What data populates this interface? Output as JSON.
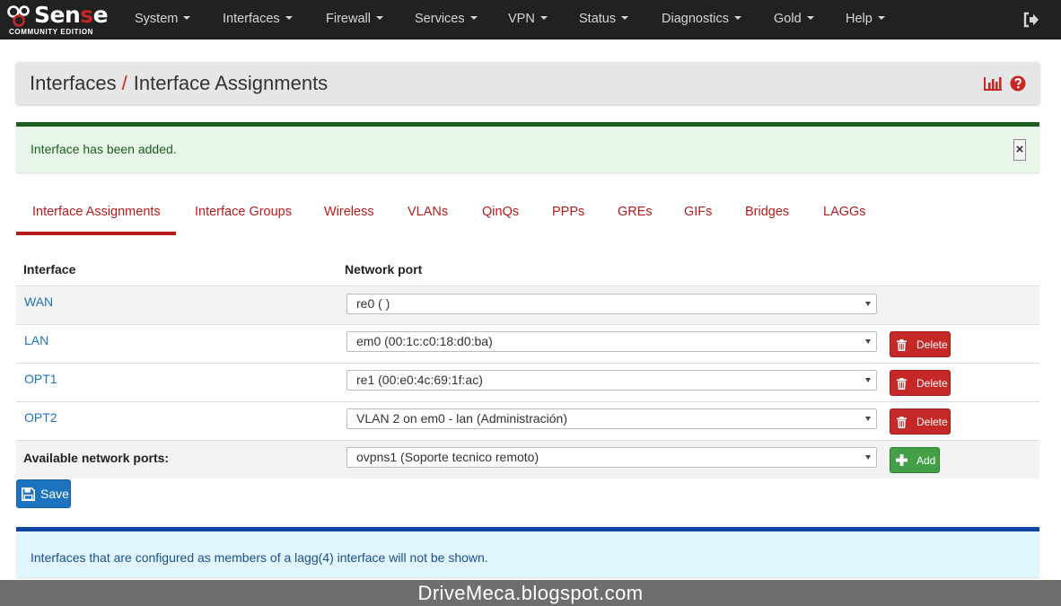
{
  "brand": {
    "name_white_1": "Sen",
    "name_red": "s",
    "name_white_2": "e",
    "edition": "COMMUNITY EDITION"
  },
  "nav": {
    "items": [
      "System",
      "Interfaces",
      "Firewall",
      "Services",
      "VPN",
      "Status",
      "Diagnostics",
      "Gold",
      "Help"
    ]
  },
  "header": {
    "section": "Interfaces",
    "separator": "/",
    "title": "Interface Assignments"
  },
  "alert_success": {
    "message": "Interface has been added.",
    "close": "×"
  },
  "tabs": [
    "Interface Assignments",
    "Interface Groups",
    "Wireless",
    "VLANs",
    "QinQs",
    "PPPs",
    "GREs",
    "GIFs",
    "Bridges",
    "LAGGs"
  ],
  "table": {
    "headers": {
      "interface": "Interface",
      "port": "Network port"
    },
    "rows": [
      {
        "interface": "WAN",
        "port": "re0 (                        )"
      },
      {
        "interface": "LAN",
        "port": "em0 (00:1c:c0:18:d0:ba)",
        "delete": "Delete"
      },
      {
        "interface": "OPT1",
        "port": "re1 (00:e0:4c:69:1f:ac)",
        "delete": "Delete"
      },
      {
        "interface": "OPT2",
        "port": "VLAN 2 on em0 - lan (Administración)",
        "delete": "Delete"
      }
    ],
    "available": {
      "label": "Available network ports:",
      "port": "ovpns1 (Soporte tecnico remoto)",
      "add": "Add"
    }
  },
  "save_label": "Save",
  "alert_info": {
    "message": "Interfaces that are configured as members of a lagg(4) interface will not be shown."
  },
  "watermark": "DriveMeca.blogspot.com",
  "colors": {
    "accent_red": "#b71c1c",
    "link_blue": "#1e73be",
    "success_green": "#1b5e20",
    "navbar": "#212121"
  }
}
